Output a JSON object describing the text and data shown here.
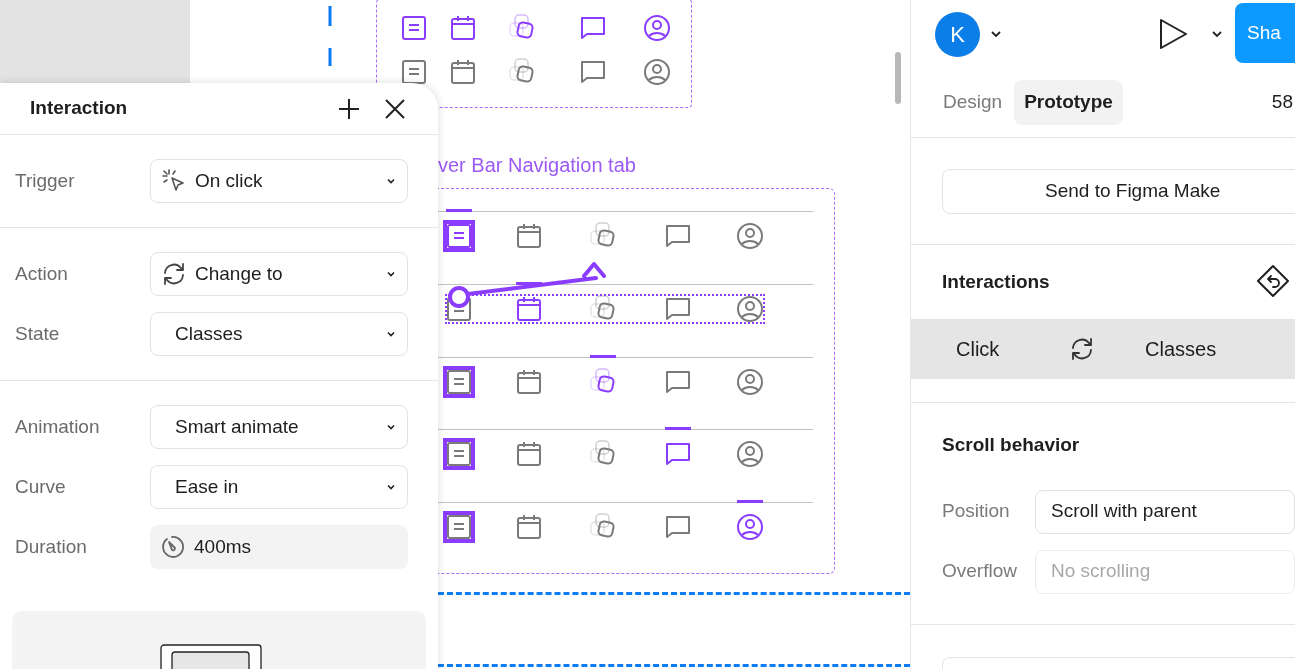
{
  "canvas": {
    "top_frame": {
      "rows": [
        {
          "icons": [
            {
              "selected": true
            },
            {
              "selected": true
            },
            {
              "selected": true
            },
            {
              "selected": true
            },
            {
              "selected": true
            }
          ]
        },
        {
          "icons": [
            {
              "selected": false
            },
            {
              "selected": false
            },
            {
              "selected": false
            },
            {
              "selected": false
            },
            {
              "selected": false
            }
          ]
        }
      ]
    },
    "frame_label": "ver Bar Navigation tab",
    "variants": [
      {
        "framed": true,
        "selected": false,
        "icons": [
          {
            "selected": true
          },
          {
            "selected": false
          },
          {
            "selected": false
          },
          {
            "selected": false
          },
          {
            "selected": false
          }
        ]
      },
      {
        "framed": false,
        "selected": true,
        "icons": [
          {
            "selected": false
          },
          {
            "selected": true
          },
          {
            "selected": false
          },
          {
            "selected": false
          },
          {
            "selected": false
          }
        ]
      },
      {
        "framed": true,
        "selected": false,
        "icons": [
          {
            "selected": false
          },
          {
            "selected": false
          },
          {
            "selected": true
          },
          {
            "selected": false
          },
          {
            "selected": false
          }
        ]
      },
      {
        "framed": true,
        "selected": false,
        "icons": [
          {
            "selected": false
          },
          {
            "selected": false
          },
          {
            "selected": false
          },
          {
            "selected": true
          },
          {
            "selected": false
          }
        ]
      },
      {
        "framed": true,
        "selected": false,
        "icons": [
          {
            "selected": false
          },
          {
            "selected": false
          },
          {
            "selected": false
          },
          {
            "selected": false
          },
          {
            "selected": true
          }
        ]
      }
    ]
  },
  "interaction_panel": {
    "title": "Interaction",
    "sections": [
      [
        {
          "label": "Trigger",
          "value": "On click",
          "kind": "select"
        }
      ],
      [
        {
          "label": "Action",
          "value": "Change to",
          "kind": "select"
        },
        {
          "label": "State",
          "value": "Classes",
          "kind": "select"
        }
      ],
      [
        {
          "label": "Animation",
          "value": "Smart animate",
          "kind": "select"
        },
        {
          "label": "Curve",
          "value": "Ease in",
          "kind": "select"
        },
        {
          "label": "Duration",
          "value": "400ms",
          "kind": "input"
        }
      ]
    ]
  },
  "right_panel": {
    "avatar": "K",
    "share": "Sha",
    "tabs": [
      {
        "label": "Design",
        "selected": false
      },
      {
        "label": "Prototype",
        "selected": true
      }
    ],
    "zoom": "58",
    "send_button": "Send to Figma Make",
    "interactions_title": "Interactions",
    "interactions": [
      {
        "trigger": "Click",
        "target": "Classes",
        "selected": true
      }
    ],
    "scroll_title": "Scroll behavior",
    "scroll_fields": [
      {
        "label": "Position",
        "value": "Scroll with parent",
        "disabled": false
      },
      {
        "label": "Overflow",
        "value": "No scrolling",
        "disabled": true
      }
    ]
  }
}
